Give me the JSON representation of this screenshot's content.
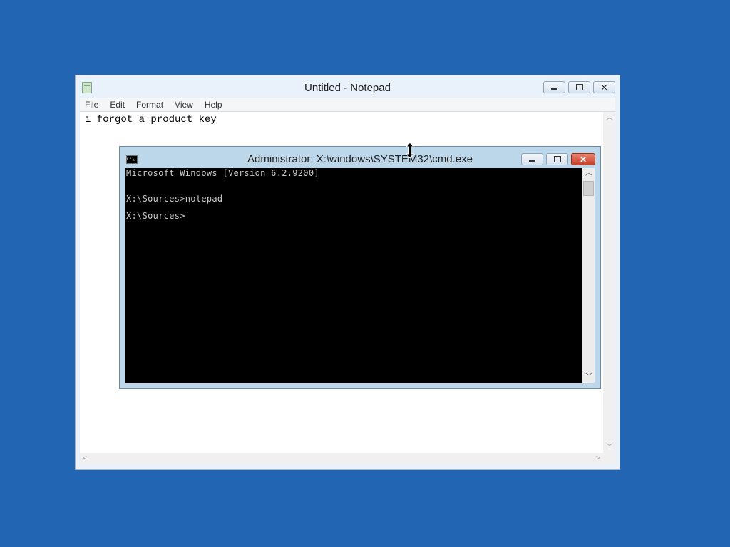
{
  "notepad": {
    "title": "Untitled - Notepad",
    "menu": [
      "File",
      "Edit",
      "Format",
      "View",
      "Help"
    ],
    "text": "i forgot a product key"
  },
  "cmd": {
    "title": "Administrator: X:\\windows\\SYSTEM32\\cmd.exe",
    "icon_text": "C:\\.",
    "lines": [
      "Microsoft Windows [Version 6.2.9200]",
      "",
      "X:\\Sources>notepad",
      "",
      "X:\\Sources>"
    ]
  },
  "icons": {
    "notepad_app": "notepad-app-icon",
    "cmd_app": "cmd-app-icon",
    "minimize": "minimize-icon",
    "maximize": "maximize-icon",
    "close": "close-icon",
    "cursor": "resize-vertical-cursor-icon",
    "scroll_up": "chevron-up-icon",
    "scroll_down": "chevron-down-icon",
    "scroll_left": "chevron-left-icon",
    "scroll_right": "chevron-right-icon"
  },
  "colors": {
    "desktop": "#2266b3",
    "close_button": "#c5402a",
    "console_bg": "#000000",
    "console_text": "#c8c8c8"
  }
}
